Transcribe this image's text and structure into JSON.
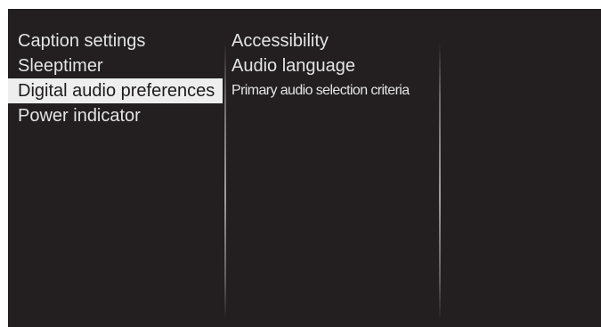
{
  "menu": {
    "level1": {
      "items": [
        {
          "label": "Caption settings"
        },
        {
          "label": "Sleeptimer"
        },
        {
          "label": "Digital audio preferences"
        },
        {
          "label": "Power indicator"
        }
      ],
      "selected_index": 2
    },
    "level2": {
      "items": [
        {
          "label": "Accessibility"
        },
        {
          "label": "Audio language"
        },
        {
          "label": "Primary audio selection criteria"
        }
      ]
    }
  },
  "colors": {
    "background": "#231f20",
    "text": "#e4e4e4",
    "highlight_background": "#eeeeee",
    "highlight_text": "#1d1b1c",
    "page_border": "#ffffff"
  }
}
